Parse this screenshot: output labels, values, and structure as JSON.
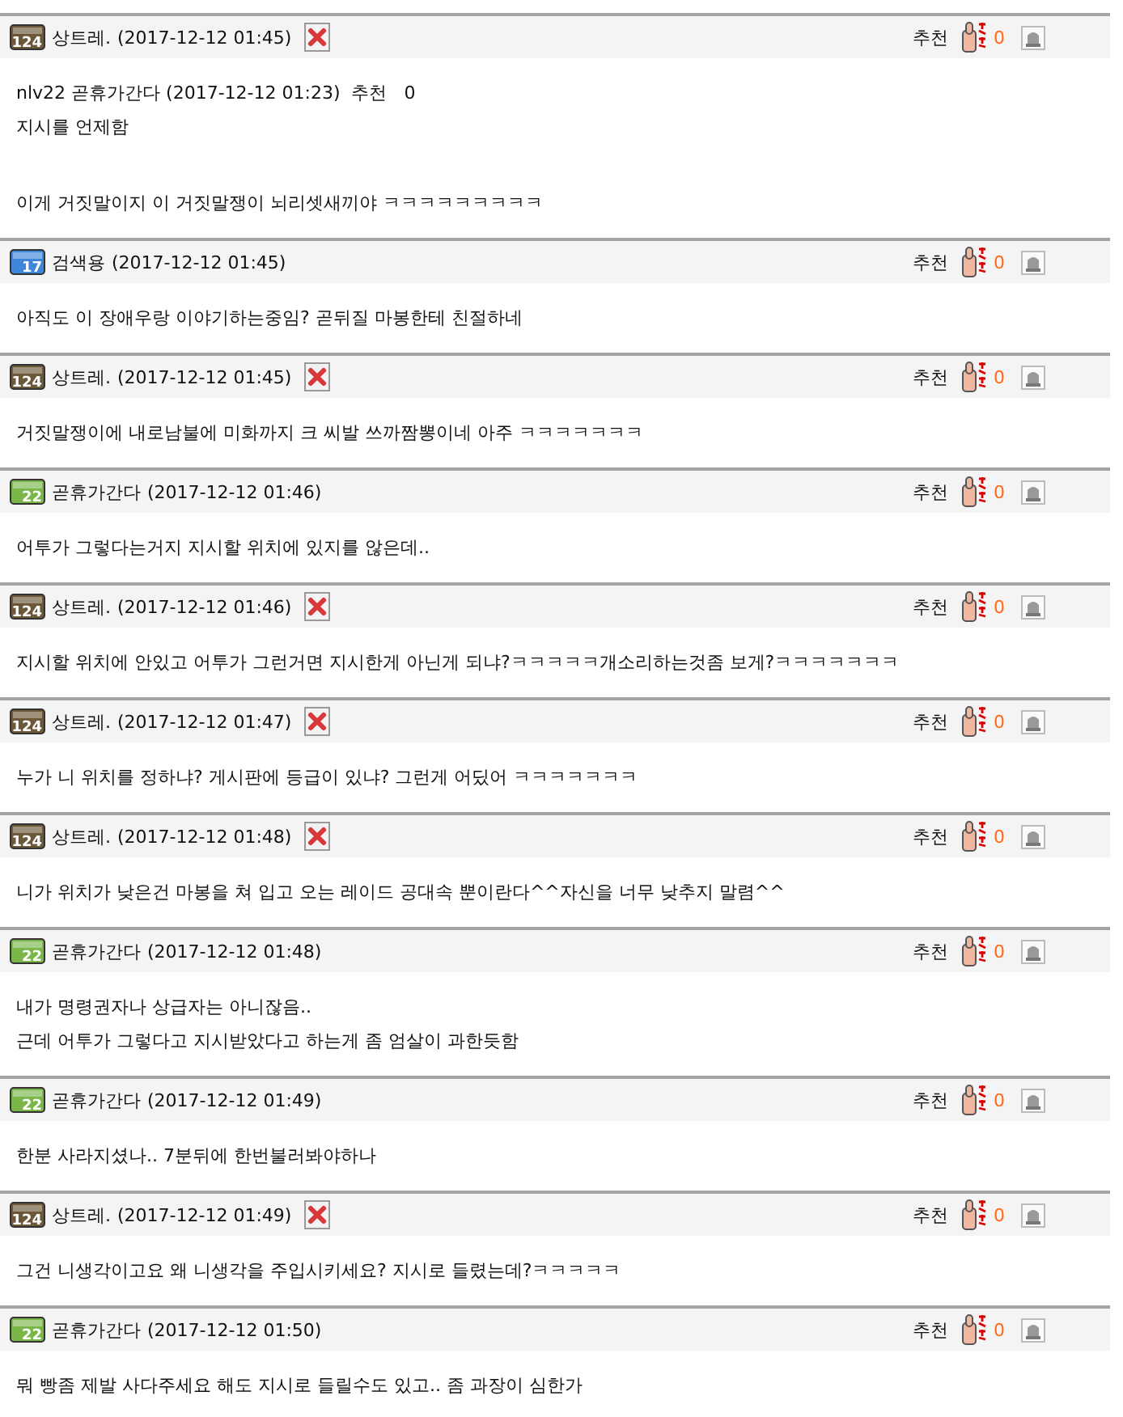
{
  "comments": [
    {
      "badge": {
        "text": "124",
        "color": "#6b5838"
      },
      "author": "상트레.",
      "time": "(2017-12-12 01:45)",
      "deletable": true,
      "rec_label": "추천",
      "rec_count": "0",
      "quote": {
        "header": "nlv22 곧휴가간다 (2017-12-12 01:23)  추천   0",
        "text": "지시를 언제함"
      },
      "lines": [
        "이게 거짓말이지 이 거짓말쟁이 뇌리셋새끼야 ㅋㅋㅋㅋㅋㅋㅋㅋㅋ"
      ]
    },
    {
      "badge": {
        "text": "17",
        "color": "#3d86d8"
      },
      "author": "검색용",
      "time": "(2017-12-12 01:45)",
      "deletable": false,
      "rec_label": "추천",
      "rec_count": "0",
      "lines": [
        "아직도 이 장애우랑 이야기하는중임? 곧뒤질 마봉한테 친절하네"
      ]
    },
    {
      "badge": {
        "text": "124",
        "color": "#6b5838"
      },
      "author": "상트레.",
      "time": "(2017-12-12 01:45)",
      "deletable": true,
      "rec_label": "추천",
      "rec_count": "0",
      "lines": [
        "거짓말쟁이에 내로남불에 미화까지 크 씨발 쓰까짬뽕이네 아주 ㅋㅋㅋㅋㅋㅋㅋ"
      ]
    },
    {
      "badge": {
        "text": "22",
        "color": "#7ab648"
      },
      "author": "곧휴가간다",
      "time": "(2017-12-12 01:46)",
      "deletable": false,
      "rec_label": "추천",
      "rec_count": "0",
      "lines": [
        "어투가 그렇다는거지 지시할 위치에 있지를 않은데.."
      ]
    },
    {
      "badge": {
        "text": "124",
        "color": "#6b5838"
      },
      "author": "상트레.",
      "time": "(2017-12-12 01:46)",
      "deletable": true,
      "rec_label": "추천",
      "rec_count": "0",
      "lines": [
        "지시할 위치에 안있고 어투가 그런거면 지시한게 아닌게 되냐?ㅋㅋㅋㅋㅋ개소리하는것좀 보게?ㅋㅋㅋㅋㅋㅋㅋ"
      ]
    },
    {
      "badge": {
        "text": "124",
        "color": "#6b5838"
      },
      "author": "상트레.",
      "time": "(2017-12-12 01:47)",
      "deletable": true,
      "rec_label": "추천",
      "rec_count": "0",
      "lines": [
        "누가 니 위치를 정하냐? 게시판에 등급이 있냐? 그런게 어딨어 ㅋㅋㅋㅋㅋㅋㅋ"
      ]
    },
    {
      "badge": {
        "text": "124",
        "color": "#6b5838"
      },
      "author": "상트레.",
      "time": "(2017-12-12 01:48)",
      "deletable": true,
      "rec_label": "추천",
      "rec_count": "0",
      "lines": [
        "니가 위치가 낮은건 마봉을 쳐 입고 오는 레이드 공대속 뿐이란다^^자신을 너무 낮추지 말렴^^"
      ]
    },
    {
      "badge": {
        "text": "22",
        "color": "#7ab648"
      },
      "author": "곧휴가간다",
      "time": "(2017-12-12 01:48)",
      "deletable": false,
      "rec_label": "추천",
      "rec_count": "0",
      "lines": [
        "내가 명령권자나 상급자는 아니잖음..",
        "근데 어투가 그렇다고 지시받았다고 하는게 좀 엄살이 과한듯함"
      ]
    },
    {
      "badge": {
        "text": "22",
        "color": "#7ab648"
      },
      "author": "곧휴가간다",
      "time": "(2017-12-12 01:49)",
      "deletable": false,
      "rec_label": "추천",
      "rec_count": "0",
      "lines": [
        "한분 사라지셨나.. 7분뒤에 한번불러봐야하나"
      ]
    },
    {
      "badge": {
        "text": "124",
        "color": "#6b5838"
      },
      "author": "상트레.",
      "time": "(2017-12-12 01:49)",
      "deletable": true,
      "rec_label": "추천",
      "rec_count": "0",
      "lines": [
        "그건 니생각이고요 왜 니생각을 주입시키세요? 지시로 들렸는데?ㅋㅋㅋㅋㅋ"
      ]
    },
    {
      "badge": {
        "text": "22",
        "color": "#7ab648"
      },
      "author": "곧휴가간다",
      "time": "(2017-12-12 01:50)",
      "deletable": false,
      "rec_label": "추천",
      "rec_count": "0",
      "lines": [
        "뭐 빵좀 제발 사다주세요 해도 지시로 들릴수도 있고.. 좀 과장이 심한가"
      ]
    }
  ]
}
